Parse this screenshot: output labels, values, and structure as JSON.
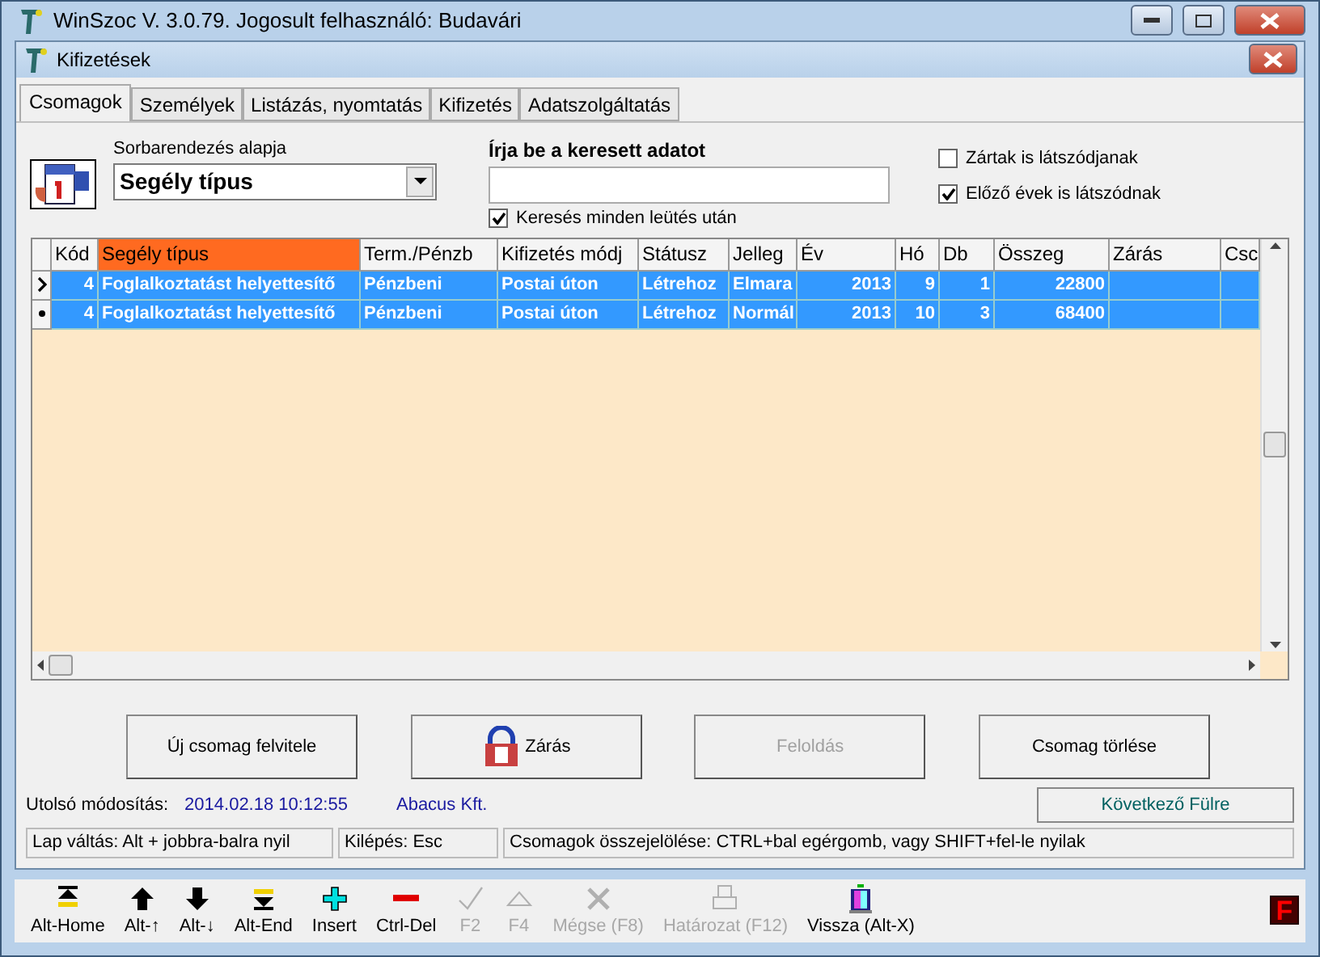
{
  "app_window": {
    "title": "WinSzoc V. 3.0.79. Jogosult felhasználó: Budavári"
  },
  "child_window": {
    "title": "Kifizetések"
  },
  "tabs": [
    {
      "label": "Csomagok",
      "selected": true
    },
    {
      "label": "Személyek",
      "selected": false
    },
    {
      "label": "Listázás, nyomtatás",
      "selected": false
    },
    {
      "label": "Kifizetés",
      "selected": false
    },
    {
      "label": "Adatszolgáltatás",
      "selected": false
    }
  ],
  "sort": {
    "label": "Sorbarendezés alapja",
    "value": "Segély típus"
  },
  "search": {
    "label": "Írja be a keresett adatot",
    "live_search": {
      "label": "Keresés minden leütés után",
      "checked": true
    }
  },
  "options": [
    {
      "label": "Zártak is látszódjanak",
      "checked": false
    },
    {
      "label": "Előző évek is látszódnak",
      "checked": true
    }
  ],
  "table": {
    "columns": [
      {
        "label": "Kód",
        "sorted": false
      },
      {
        "label": "Segély típus",
        "sorted": true
      },
      {
        "label": "Term./Pénzb",
        "sorted": false
      },
      {
        "label": "Kifizetés módj",
        "sorted": false
      },
      {
        "label": "Státusz",
        "sorted": false
      },
      {
        "label": "Jelleg",
        "sorted": false
      },
      {
        "label": "Év",
        "sorted": false
      },
      {
        "label": "Hó",
        "sorted": false
      },
      {
        "label": "Db",
        "sorted": false
      },
      {
        "label": "Összeg",
        "sorted": false
      },
      {
        "label": "Zárás",
        "sorted": false
      },
      {
        "label": "Csc",
        "sorted": false
      }
    ],
    "rows": [
      {
        "kind": "current",
        "selected": true,
        "cells": [
          "4",
          "Foglalkoztatást helyettesítő",
          "Pénzbeni",
          "Postai úton",
          "Létrehoz",
          "Elmara",
          "2013",
          "9",
          "1",
          "22800",
          "",
          ""
        ]
      },
      {
        "kind": "marked",
        "selected": true,
        "cells": [
          "4",
          "Foglalkoztatást helyettesítő",
          "Pénzbeni",
          "Postai úton",
          "Létrehoz",
          "Normál",
          "2013",
          "10",
          "3",
          "68400",
          "",
          ""
        ]
      }
    ]
  },
  "buttons": [
    {
      "label": "Új csomag felvitele",
      "kind": "plain",
      "disabled": false
    },
    {
      "label": "Zárás",
      "kind": "lock",
      "disabled": false
    },
    {
      "label": "Feloldás",
      "kind": "plain",
      "disabled": true
    },
    {
      "label": "Csomag törlése",
      "kind": "plain",
      "disabled": false
    }
  ],
  "last_modified": {
    "label": "Utolsó módosítás:",
    "value": "2014.02.18 10:12:55",
    "company": "Abacus Kft."
  },
  "next_tab_button": "Következő Fülre",
  "hints": [
    "Lap váltás: Alt + jobbra-balra nyil",
    "Kilépés: Esc",
    "Csomagok összejelölése: CTRL+bal egérgomb, vagy SHIFT+fel-le nyilak"
  ],
  "toolbar": [
    {
      "label": "Alt-Home",
      "kind": "first",
      "disabled": false
    },
    {
      "label": "Alt-↑",
      "kind": "up",
      "disabled": false
    },
    {
      "label": "Alt-↓",
      "kind": "down",
      "disabled": false
    },
    {
      "label": "Alt-End",
      "kind": "last",
      "disabled": false
    },
    {
      "label": "Insert",
      "kind": "insert",
      "disabled": false
    },
    {
      "label": "Ctrl-Del",
      "kind": "delete",
      "disabled": false
    },
    {
      "label": "F2",
      "kind": "check",
      "disabled": true
    },
    {
      "label": "F4",
      "kind": "triangle",
      "disabled": true
    },
    {
      "label": "Mégse (F8)",
      "kind": "cancel",
      "disabled": true
    },
    {
      "label": "Határozat (F12)",
      "kind": "print",
      "disabled": true
    },
    {
      "label": "Vissza (Alt-X)",
      "kind": "exit",
      "disabled": false
    }
  ],
  "corner_badge": "F"
}
